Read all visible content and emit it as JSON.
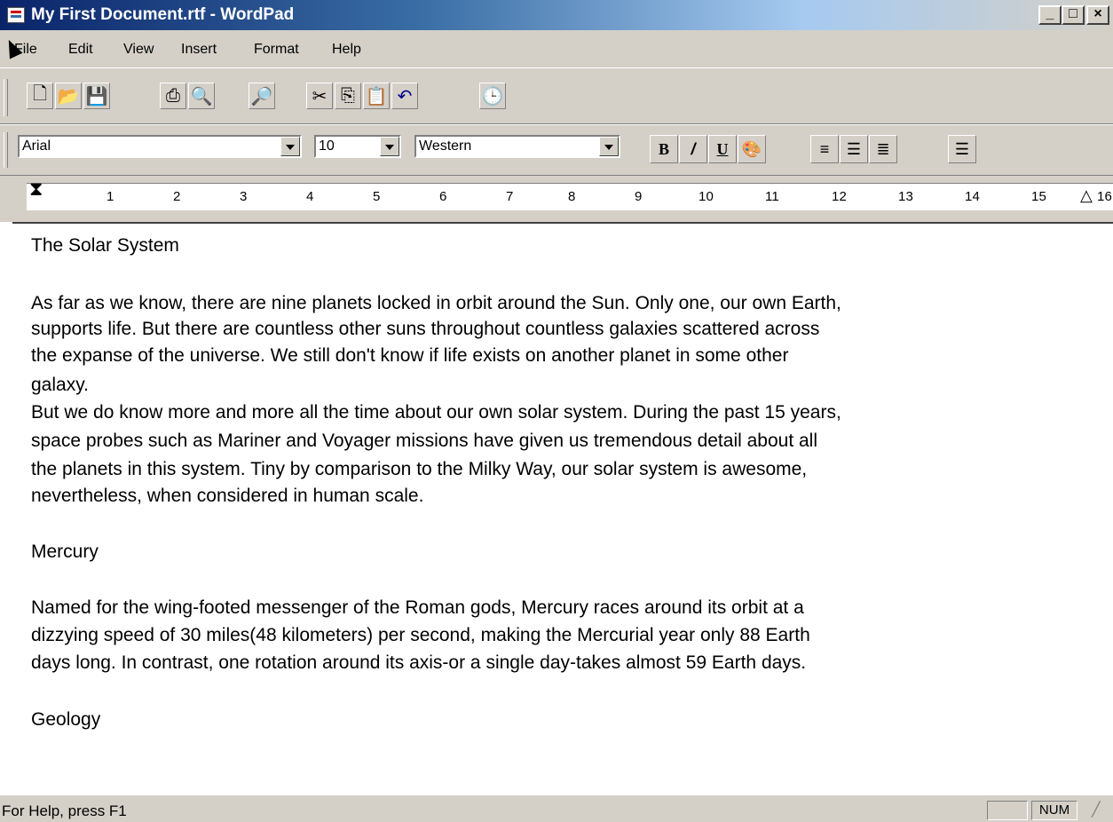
{
  "window": {
    "title": "My First Document.rtf - WordPad",
    "minimize": "_",
    "maximize": "□",
    "close": "×"
  },
  "menu": [
    "File",
    "Edit",
    "View",
    "Insert",
    "Format",
    "Help"
  ],
  "toolbar_icons": [
    "new-icon",
    "open-icon",
    "save-icon",
    "print-icon",
    "print-preview-icon",
    "find-icon",
    "cut-icon",
    "copy-icon",
    "paste-icon",
    "undo-icon",
    "date-time-icon"
  ],
  "format_bar": {
    "font": "Arial",
    "size": "10",
    "script": "Western",
    "bold": "B",
    "italic": "/",
    "underline": "U"
  },
  "ruler": {
    "numbers": [
      "1",
      "2",
      "3",
      "4",
      "5",
      "6",
      "7",
      "8",
      "9",
      "10",
      "11",
      "12",
      "13",
      "14",
      "15",
      "16"
    ]
  },
  "document": {
    "lines": [
      "The Solar System",
      "",
      "As far as we know, there are nine planets locked in orbit around the Sun. Only one, our own Earth,",
      "supports life. But there are countless other suns throughout countless galaxies scattered across",
      "the expanse of the universe. We still don't know if life exists on another planet in some other",
      "galaxy.",
      "But we do know more and more all the time about our own solar system. During the past 15 years,",
      "space probes such as Mariner and Voyager missions have given us tremendous detail about all",
      "the planets in this system. Tiny by comparison to the Milky Way, our solar system is awesome,",
      "nevertheless, when considered in human scale.",
      "",
      "Mercury",
      "",
      "Named for the wing-footed messenger of the Roman gods, Mercury races around its orbit at a",
      "dizzying speed of 30 miles(48 kilometers) per second, making the Mercurial year only 88 Earth",
      "days long. In contrast, one rotation around its axis-or a single day-takes almost 59 Earth days.",
      "",
      "Geology"
    ]
  },
  "status": {
    "help": "For Help, press F1",
    "num": "NUM"
  }
}
